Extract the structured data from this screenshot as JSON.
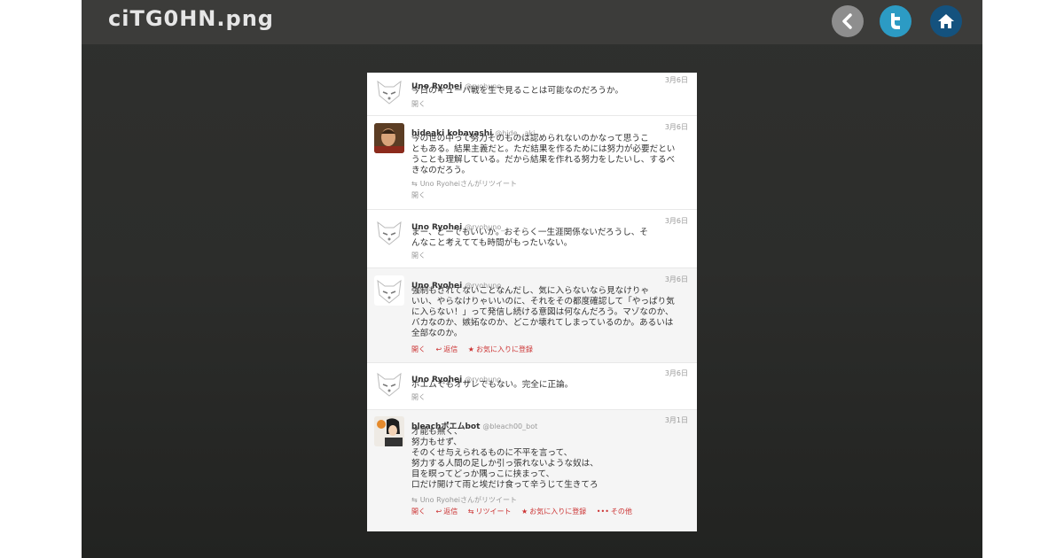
{
  "viewer": {
    "title": "ciTG0HN.png",
    "buttons": {
      "back": "back-icon",
      "twitter": "twitter-icon",
      "home": "home-icon"
    }
  },
  "colors": {
    "background": "#2c2d2b",
    "topbar": "#3c3c3a",
    "back_button": "#8e8e8e",
    "twitter_button": "#2c9bc4",
    "home_button": "#14527e",
    "action_red": "#cc3333"
  },
  "tweets": [
    {
      "name": "Uno Ryohei",
      "handle": "@ryohuno_",
      "date": "3月6日",
      "text": "今日のキューバ戦を生で見ることは可能なのだろうか。",
      "open": "開く"
    },
    {
      "name": "hideaki kobayashi",
      "handle": "@hide__aki",
      "date": "3月6日",
      "text": "今の世の中って努力そのものは認められないのかなって思うこ\nともある。結果主義だと。ただ結果を作るためには努力が必要だとい\nうことも理解している。だから結果を作れる努力をしたいし、するべ\nきなのだろう。",
      "retweet": "Uno Ryoheiさんがリツイート",
      "open": "開く"
    },
    {
      "name": "Uno Ryohei",
      "handle": "@ryohuno_",
      "date": "3月6日",
      "text": "まー、どーでもいいか。おそらく一生涯関係ないだろうし、そ\nんなこと考えてても時間がもったいない。",
      "open": "開く"
    },
    {
      "name": "Uno Ryohei",
      "handle": "@ryohuno_",
      "date": "3月6日",
      "text": "強制もされてないことなんだし、気に入らないなら見なけりゃ\nいい、やらなけりゃいいのに、それをその都度確認して「やっぱり気\nに入らない！」って発信し続ける意図は何なんだろう。マゾなのか、\nバカなのか、嫉妬なのか、どこか壊れてしまっているのか。あるいは\n全部なのか。",
      "open": "開く",
      "reply": "返信",
      "favorite": "お気に入りに登録"
    },
    {
      "name": "Uno Ryohei",
      "handle": "@ryohuno_",
      "date": "3月6日",
      "text": "ポエムでもオサレでもない。完全に正論。",
      "open": "開く"
    },
    {
      "name": "bleachポエムbot",
      "handle": "@bleach00_bot",
      "date": "3月1日",
      "text": "才能も無く、\n努力もせず、\nそのくせ与えられるものに不平を言って、\n努力する人間の足しか引っ張れないような奴は、\n目を瞑ってどっか隅っこに挟まって、\n口だけ開けて雨と埃だけ食って辛うじて生きてろ",
      "retweet": "Uno Ryoheiさんがリツイート",
      "open": "開く",
      "reply": "返信",
      "rt": "リツイート",
      "favorite": "お気に入りに登録",
      "more": "その他"
    }
  ]
}
